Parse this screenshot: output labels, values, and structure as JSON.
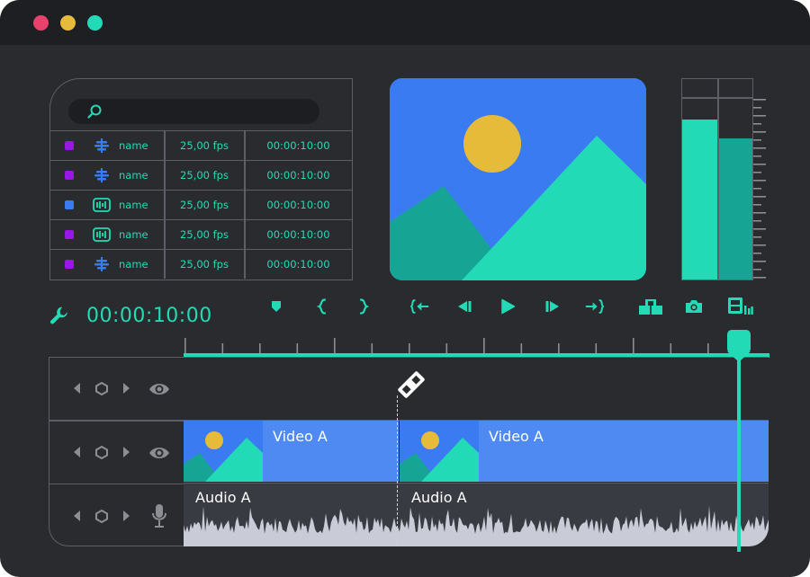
{
  "window": {
    "controls": [
      "close",
      "minimize",
      "maximize"
    ],
    "colors": {
      "close": "#e8416c",
      "minimize": "#e7bb3a",
      "maximize": "#22dbb6"
    }
  },
  "browser": {
    "search": {
      "placeholder": ""
    },
    "rows": [
      {
        "color": "#9b16e8",
        "icon": "audio-levels-icon",
        "name": "name",
        "fps": "25,00 fps",
        "duration": "00:00:10:00"
      },
      {
        "color": "#9b16e8",
        "icon": "audio-levels-icon",
        "name": "name",
        "fps": "25,00 fps",
        "duration": "00:00:10:00"
      },
      {
        "color": "#3b7bf2",
        "icon": "film-icon",
        "name": "name",
        "fps": "25,00 fps",
        "duration": "00:00:10:00"
      },
      {
        "color": "#9b16e8",
        "icon": "film-icon",
        "name": "name",
        "fps": "25,00 fps",
        "duration": "00:00:10:00"
      },
      {
        "color": "#9b16e8",
        "icon": "audio-levels-icon",
        "name": "name",
        "fps": "25,00 fps",
        "duration": "00:00:10:00"
      }
    ]
  },
  "meter": {
    "levels": [
      0.82,
      0.75
    ]
  },
  "transport": {
    "timecode": "00:00:10:00",
    "buttons": [
      "marker",
      "mark-in",
      "mark-out",
      "go-to-start",
      "step-back",
      "play",
      "step-forward",
      "go-to-end",
      "overwrite",
      "snapshot",
      "export-frame"
    ]
  },
  "timeline": {
    "playhead_fraction": 0.95,
    "tracks": [
      {
        "type": "keyframes",
        "visibility_icon": "eye-icon"
      },
      {
        "type": "video",
        "visibility_icon": "eye-icon",
        "clips": [
          {
            "label": "Video A"
          },
          {
            "label": "Video A"
          }
        ]
      },
      {
        "type": "audio",
        "visibility_icon": "microphone-icon",
        "clips": [
          {
            "label": "Audio A"
          },
          {
            "label": "Audio A"
          }
        ]
      }
    ]
  }
}
